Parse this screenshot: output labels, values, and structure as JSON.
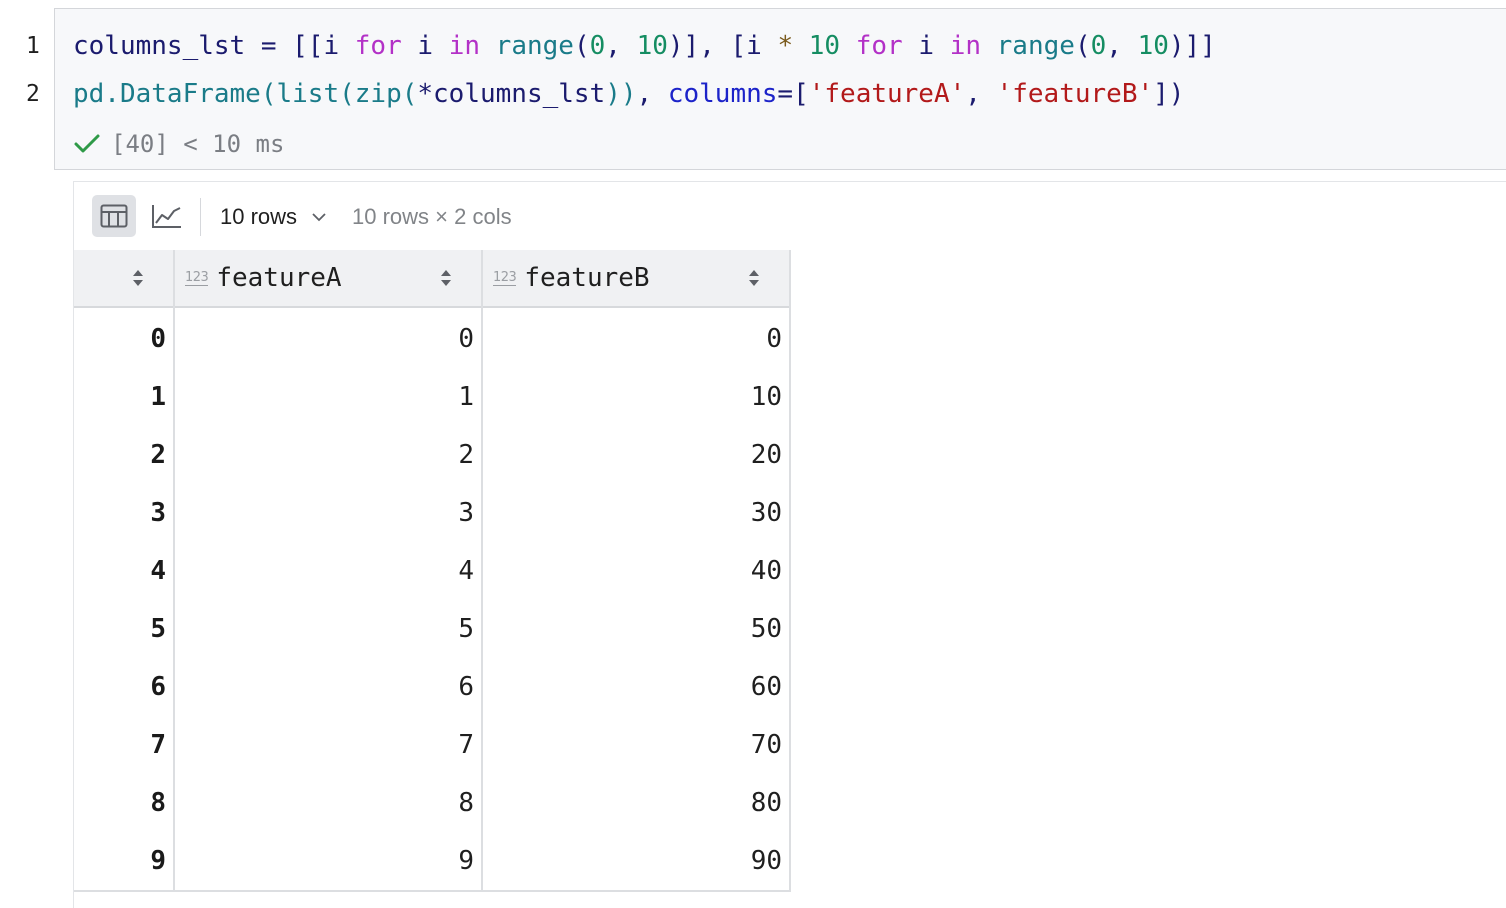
{
  "code_cell": {
    "line_numbers": [
      "1",
      "2"
    ],
    "line1": {
      "t1": "columns_lst = [[i ",
      "k1": "for",
      "t2": " i ",
      "k2": "in",
      "t3": " ",
      "f1": "range",
      "t4": "(",
      "n1": "0",
      "t5": ", ",
      "n2": "10",
      "t6": ")], [i ",
      "o1": "*",
      "t7": " ",
      "n3": "10",
      "t8": " ",
      "k3": "for",
      "t9": " i ",
      "k4": "in",
      "t10": " ",
      "f2": "range",
      "t11": "(",
      "n4": "0",
      "t12": ", ",
      "n5": "10",
      "t13": ")]]"
    },
    "line2": {
      "f1": "pd.DataFrame(list(zip(",
      "t1": "*columns_lst",
      "f2": "))",
      "t2": ", ",
      "p1": "columns",
      "t3": "=[",
      "s1": "'featureA'",
      "t4": ", ",
      "s2": "'featureB'",
      "t5": "])"
    },
    "status_text": "[40] < 10 ms",
    "status_color": "#2e9a47"
  },
  "toolbar": {
    "table_view_icon": "table-icon",
    "chart_view_icon": "line-chart-icon",
    "rows_dropdown_value": "10 rows",
    "shape_label": "10 rows × 2 cols"
  },
  "table": {
    "columns": [
      {
        "name": "featureA",
        "type_badge": "123"
      },
      {
        "name": "featureB",
        "type_badge": "123"
      }
    ],
    "rows": [
      {
        "index": "0",
        "featureA": "0",
        "featureB": "0"
      },
      {
        "index": "1",
        "featureA": "1",
        "featureB": "10"
      },
      {
        "index": "2",
        "featureA": "2",
        "featureB": "20"
      },
      {
        "index": "3",
        "featureA": "3",
        "featureB": "30"
      },
      {
        "index": "4",
        "featureA": "4",
        "featureB": "40"
      },
      {
        "index": "5",
        "featureA": "5",
        "featureB": "50"
      },
      {
        "index": "6",
        "featureA": "6",
        "featureB": "60"
      },
      {
        "index": "7",
        "featureA": "7",
        "featureB": "70"
      },
      {
        "index": "8",
        "featureA": "8",
        "featureB": "80"
      },
      {
        "index": "9",
        "featureA": "9",
        "featureB": "90"
      }
    ]
  }
}
